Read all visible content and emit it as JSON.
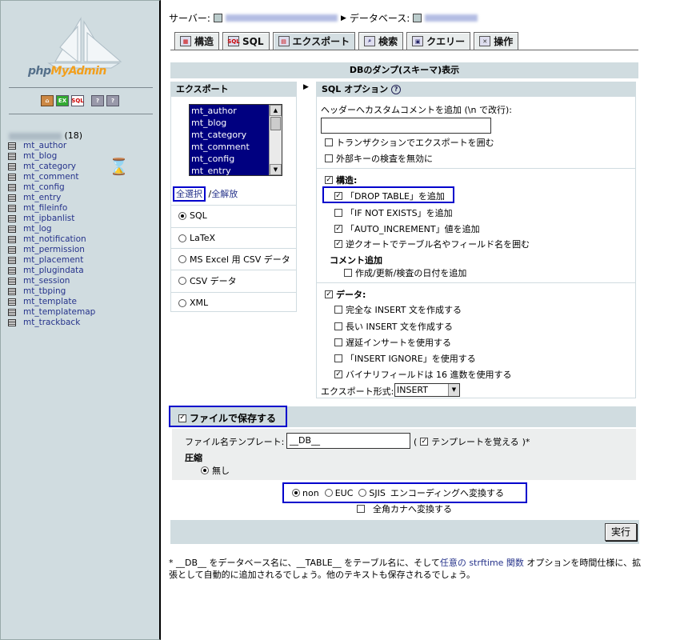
{
  "left": {
    "logo_text_main": "php",
    "logo_text_accent": "MyAdmin",
    "icons": [
      "home-icon",
      "exit-icon",
      "sql-icon",
      "help-icon",
      "docs-icon"
    ],
    "db_count": "(18)",
    "tables": [
      "mt_author",
      "mt_blog",
      "mt_category",
      "mt_comment",
      "mt_config",
      "mt_entry",
      "mt_fileinfo",
      "mt_ipbanlist",
      "mt_log",
      "mt_notification",
      "mt_permission",
      "mt_placement",
      "mt_plugindata",
      "mt_session",
      "mt_tbping",
      "mt_template",
      "mt_templatemap",
      "mt_trackback"
    ]
  },
  "crumb": {
    "server_label": "サーバー:",
    "db_label": "データベース:"
  },
  "tabs": [
    {
      "label": "構造",
      "icon": "structure-icon"
    },
    {
      "label": "SQL",
      "icon": "sql-icon"
    },
    {
      "label": "エクスポート",
      "icon": "export-icon",
      "active": true
    },
    {
      "label": "検索",
      "icon": "search-icon"
    },
    {
      "label": "クエリー",
      "icon": "query-icon"
    },
    {
      "label": "操作",
      "icon": "operations-icon"
    }
  ],
  "dump_title": "DBのダンプ(スキーマ)表示",
  "export": {
    "header": "エクスポート",
    "tables_visible": [
      "mt_author",
      "mt_blog",
      "mt_category",
      "mt_comment",
      "mt_config",
      "mt_entry"
    ],
    "select_all": "全選択",
    "separator": "/",
    "deselect_all": "全解放",
    "formats": [
      {
        "label": "SQL",
        "checked": true
      },
      {
        "label": "LaTeX",
        "checked": false
      },
      {
        "label": "MS Excel 用 CSV データ",
        "checked": false
      },
      {
        "label": "CSV データ",
        "checked": false
      },
      {
        "label": "XML",
        "checked": false
      }
    ]
  },
  "sql": {
    "header": "SQL オプション",
    "comment_label": "ヘッダーへカスタムコメントを追加 (\\n で改行):",
    "comment_value": "",
    "transaction": "トランザクションでエクスポートを囲む",
    "disable_fk": "外部キーの検査を無効に",
    "structure_label": "構造:",
    "drop_table": "「DROP TABLE」を追加",
    "if_not_exists": "「IF NOT EXISTS」を追加",
    "auto_increment": "「AUTO_INCREMENT」値を追加",
    "backquotes": "逆クオートでテーブル名やフィールド名を囲む",
    "comments_label": "コメント追加",
    "dates": "作成/更新/検査の日付を追加",
    "data_label": "データ:",
    "complete_insert": "完全な INSERT 文を作成する",
    "extended_insert": "長い INSERT 文を作成する",
    "delayed_insert": "遅延インサートを使用する",
    "insert_ignore": "「INSERT IGNORE」を使用する",
    "hex_binary": "バイナリフィールドは 16 進数を使用する",
    "export_type_label": "エクスポート形式:",
    "export_type_value": "INSERT"
  },
  "save": {
    "save_label": "ファイルで保存する",
    "template_label": "ファイル名テンプレート:",
    "template_value": "__DB__",
    "remember_pre": "(",
    "remember_label": "テンプレートを覚える",
    "remember_post": ")*",
    "compress_label": "圧縮",
    "compress_none": "無し"
  },
  "encoding": {
    "options": [
      "non",
      "EUC",
      "SJIS"
    ],
    "selected": "non",
    "label": "エンコーディングへ変換する",
    "zenkaku": "全角カナへ変換する"
  },
  "go_button": "実行",
  "footnote": {
    "pre": "* __DB__ をデータベース名に、__TABLE__ をテーブル名に、そして",
    "link": "任意の strftime 関数",
    "post": "オプションを時間仕様に、拡張として自動的に追加されるでしょう。他のテキストも保存されるでしょう。"
  }
}
